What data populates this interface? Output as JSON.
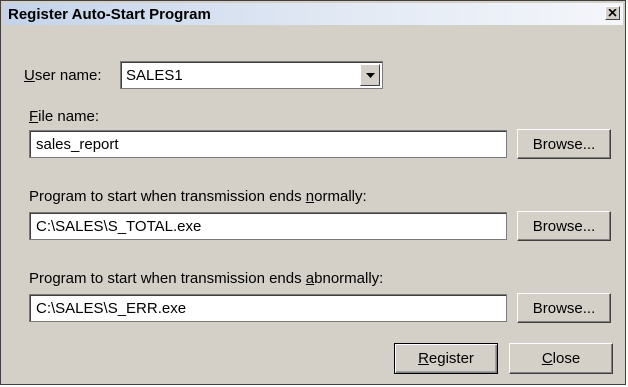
{
  "window": {
    "title": "Register Auto-Start Program",
    "close_icon": "close-x-icon"
  },
  "user": {
    "label_mnemonic": "U",
    "label_rest": "ser name:",
    "value": "SALES1"
  },
  "file": {
    "label_mnemonic": "F",
    "label_rest": "ile name:",
    "value": "sales_report",
    "browse": "Browse..."
  },
  "normal": {
    "label_pre": "Program to start when transmission ends ",
    "label_mnemonic": "n",
    "label_post": "ormally:",
    "value": "C:\\SALES\\S_TOTAL.exe",
    "browse": "Browse..."
  },
  "abnormal": {
    "label_pre": "Program to start when transmission ends ",
    "label_mnemonic": "a",
    "label_post": "bnormally:",
    "value": "C:\\SALES\\S_ERR.exe",
    "browse": "Browse..."
  },
  "buttons": {
    "register_mnemonic": "R",
    "register_rest": "egister",
    "close_mnemonic": "C",
    "close_rest": "lose"
  }
}
